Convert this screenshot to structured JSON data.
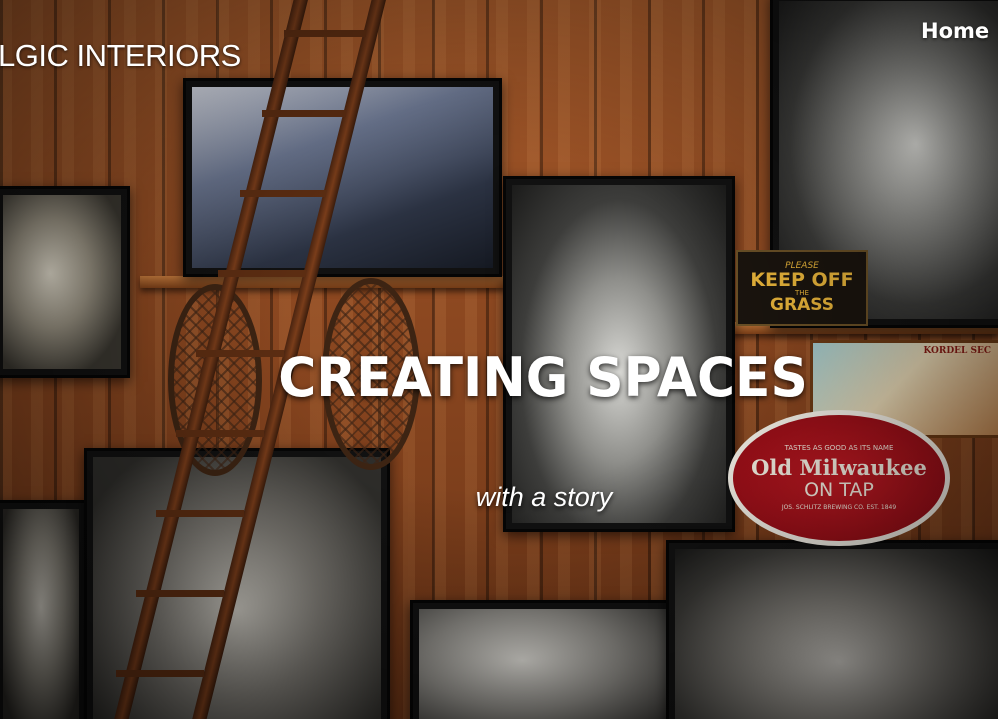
{
  "header": {
    "brand": "LGIC INTERIORS",
    "nav": [
      {
        "label": "Home"
      }
    ]
  },
  "hero": {
    "headline": "CREATING SPACES",
    "subheadline": "with a story",
    "signs": {
      "keep_off": {
        "line1": "PLEASE",
        "line2": "KEEP OFF",
        "line3": "THE",
        "line4": "GRASS"
      },
      "kordel": "KORDEL SEC",
      "old_milwaukee": {
        "top": "TASTES AS GOOD AS ITS NAME",
        "main": "Old Milwaukee",
        "sub": "ON TAP",
        "bottom": "JOS. SCHLITZ BREWING CO. EST. 1849"
      }
    }
  },
  "colors": {
    "text": "#ffffff",
    "wood": "#8b4720",
    "sign_red": "#b3121c",
    "sign_gold": "#e8b43a"
  }
}
